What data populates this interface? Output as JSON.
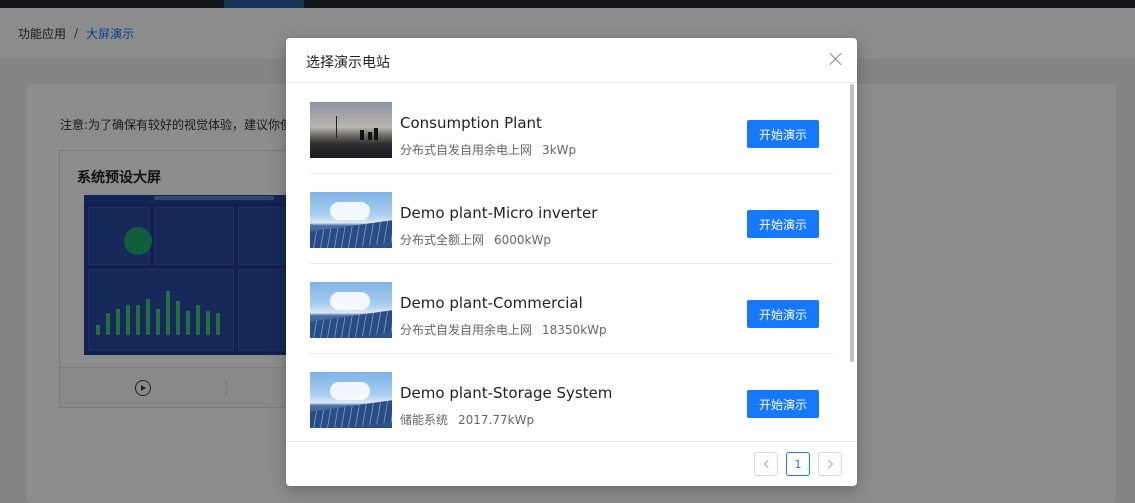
{
  "breadcrumb": {
    "parent": "功能应用",
    "separator": "/",
    "current": "大屏演示"
  },
  "page": {
    "notice": "注意:为了确保有较好的视觉体验，建议你使用",
    "screen_card": {
      "title": "系统预设大屏"
    }
  },
  "modal": {
    "title": "选择演示电站",
    "plants": [
      {
        "name": "Consumption Plant",
        "type": "分布式自发自用余电上网",
        "capacity": "3kWp",
        "button": "开始演示",
        "thumbnail": "dusk-landscape"
      },
      {
        "name": "Demo plant-Micro inverter",
        "type": "分布式全额上网",
        "capacity": "6000kWp",
        "button": "开始演示",
        "thumbnail": "solar-panels"
      },
      {
        "name": "Demo plant-Commercial",
        "type": "分布式自发自用余电上网",
        "capacity": "18350kWp",
        "button": "开始演示",
        "thumbnail": "solar-panels"
      },
      {
        "name": "Demo plant-Storage System",
        "type": "储能系统",
        "capacity": "2017.77kWp",
        "button": "开始演示",
        "thumbnail": "solar-panels"
      }
    ],
    "pagination": {
      "current_page": "1"
    }
  },
  "colors": {
    "accent": "#1677ff",
    "overlay": "rgba(0,0,0,0.45)"
  }
}
